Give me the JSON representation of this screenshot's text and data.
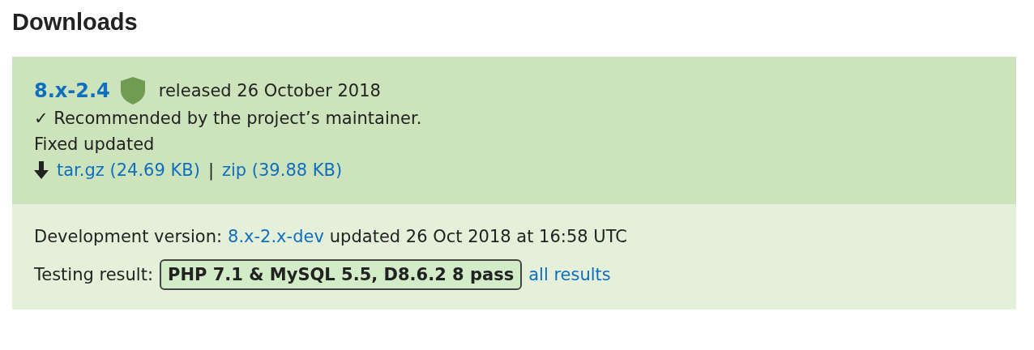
{
  "heading": "Downloads",
  "release": {
    "version": "8.x-2.4",
    "released": "released 26 October 2018",
    "recommended": "✓ Recommended by the project’s maintainer.",
    "note": "Fixed updated",
    "downloads": [
      {
        "label": "tar.gz (24.69 KB)"
      },
      {
        "label": "zip (39.88 KB)"
      }
    ],
    "separator": "|"
  },
  "development": {
    "label": "Development version:",
    "link": "8.x-2.x-dev",
    "updated": "updated 26 Oct 2018 at 16:58 UTC"
  },
  "testing": {
    "label": "Testing result:",
    "badge": "PHP 7.1 & MySQL 5.5, D8.6.2 8 pass",
    "link": "all results"
  }
}
